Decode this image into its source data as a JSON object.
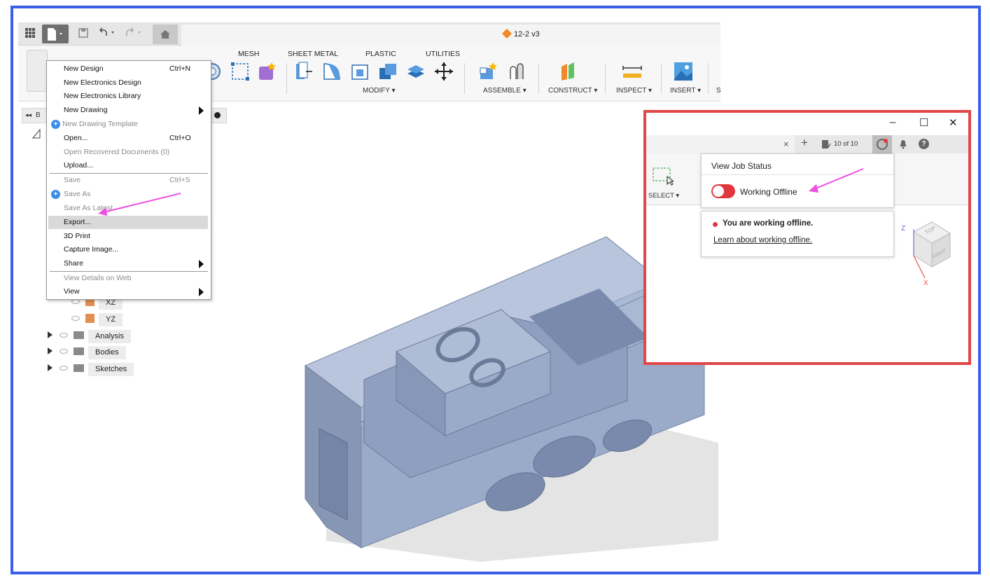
{
  "qat": {
    "grid_icon": "grid-icon",
    "file_icon": "file-icon",
    "save_icon": "save-icon",
    "undo_icon": "undo-icon",
    "redo_icon": "redo-icon",
    "home_icon": "home-icon",
    "document_title": "12-2 v3"
  },
  "ribbon": {
    "tabs": [
      "MESH",
      "SHEET METAL",
      "PLASTIC",
      "UTILITIES"
    ],
    "groups": [
      "MODIFY ▾",
      "ASSEMBLE ▾",
      "CONSTRUCT ▾",
      "INSPECT ▾",
      "INSERT ▾",
      "S"
    ]
  },
  "file_menu": {
    "items": [
      {
        "label": "New Design",
        "shortcut": "Ctrl+N"
      },
      {
        "label": "New Electronics Design"
      },
      {
        "label": "New Electronics Library"
      },
      {
        "label": "New Drawing"
      },
      {
        "label": "New Drawing Template"
      },
      {
        "label": "Open...",
        "shortcut": "Ctrl+O"
      },
      {
        "label": "Open Recovered Documents (0)"
      },
      {
        "label": "Upload..."
      },
      {
        "label": "Save",
        "shortcut": "Ctrl+S"
      },
      {
        "label": "Save As"
      },
      {
        "label": "Save As Latest"
      },
      {
        "label": "Export..."
      },
      {
        "label": "3D Print"
      },
      {
        "label": "Capture Image..."
      },
      {
        "label": "Share"
      },
      {
        "label": "View Details on Web"
      },
      {
        "label": "View"
      }
    ]
  },
  "browser": {
    "collapse_label": "B",
    "rows": [
      "XZ",
      "YZ",
      "Analysis",
      "Bodies",
      "Sketches"
    ]
  },
  "inset": {
    "window_controls": [
      "–",
      "☐",
      "✕"
    ],
    "job_count": "10 of 10",
    "select_label": "SELECT ▾",
    "job_status_title": "View Job Status",
    "toggle_label": "Working Offline",
    "offline_message": "You are working offline.",
    "offline_link": "Learn about working offline.",
    "viewcube": {
      "top": "TOP",
      "right": "RIGHT",
      "z": "Z",
      "x": "X"
    }
  },
  "colors": {
    "frame_border": "#3b5ee8",
    "inset_border": "#e04848",
    "annotation_arrow": "#ee4fe3",
    "model": "#9aaac9",
    "toggle_off": "#e0383e"
  }
}
